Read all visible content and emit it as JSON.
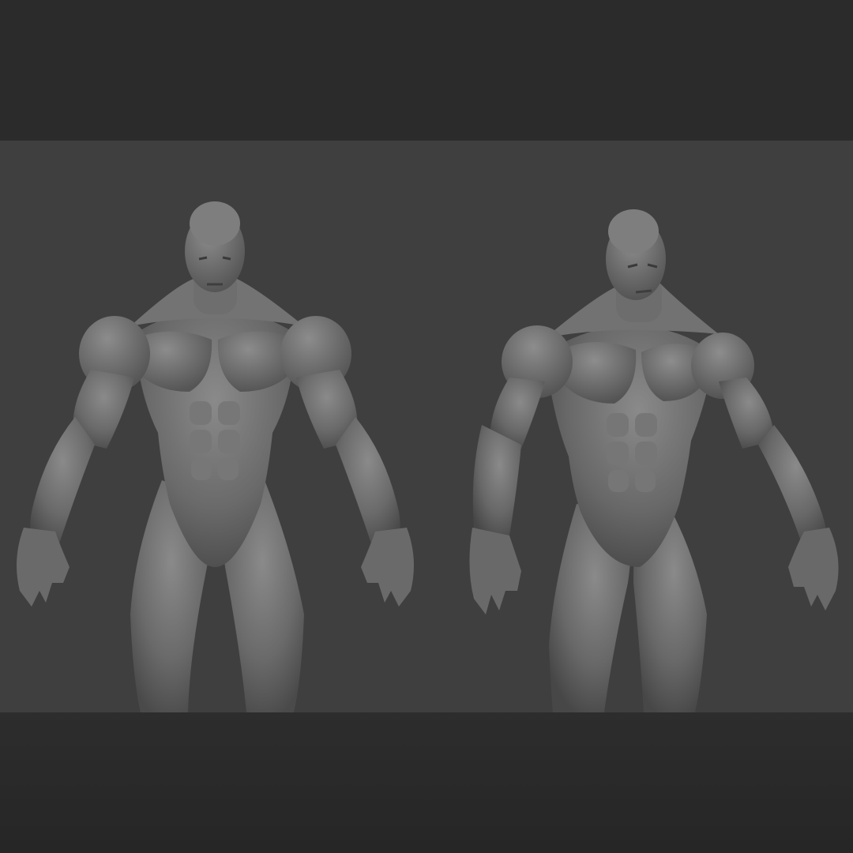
{
  "scene": {
    "background_color": "#3f3f3f",
    "band_color": "#2b2b2b",
    "material_color": "#6f6f6f",
    "views": [
      {
        "name": "front-view"
      },
      {
        "name": "three-quarter-view"
      }
    ]
  }
}
